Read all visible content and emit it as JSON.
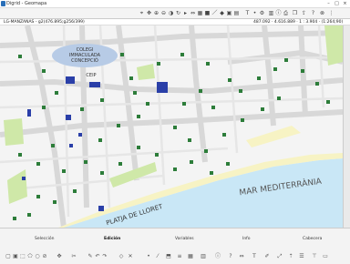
{
  "window": {
    "title": "Digrid - Geomapa",
    "minimize_icon": "minimize-icon",
    "maximize_icon": "maximize-icon",
    "close_icon": "close-icon"
  },
  "infobar": {
    "layer": "LG-MANZANAS - g2(476.895;g256/399)",
    "coords": "487.092 · 4.616.889 · 1 : 3.904 · (1:264;90)"
  },
  "map": {
    "labels": {
      "school": "COLEGI\nIMMACULADA\nCONCEPCIÓ",
      "school_l1": "COLEGI",
      "school_l2": "IMMACULADA",
      "school_l3": "CONCEPCIÓ",
      "ceip": "CEIP",
      "sea": "MAR MEDITERRÀNIA",
      "beach": "PLATJA DE LLORET"
    },
    "colors": {
      "sea": "#c9e7f6",
      "beach": "#f7f3c4",
      "park": "#cfe8a8",
      "school": "#b7cbe6",
      "tree": "#2d7d3a",
      "blocks": "#ffffff",
      "roads": "#dcdcdc"
    }
  },
  "bottom": {
    "groups": [
      "Selección",
      "Edición",
      "Variables",
      "Info",
      "Cabecera"
    ]
  }
}
